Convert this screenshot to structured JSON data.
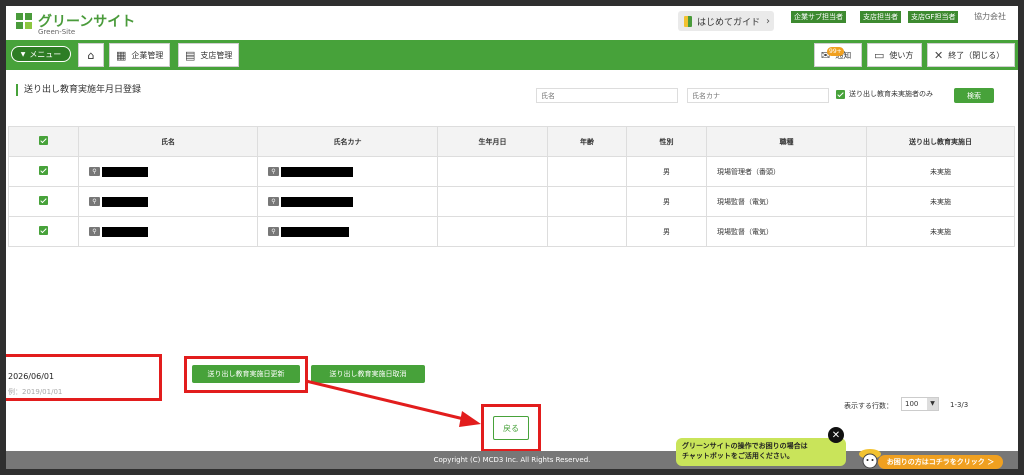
{
  "header": {
    "logo_text": "グリーンサイト",
    "logo_sub": "Green-Site",
    "guide_label": "はじめてガイド",
    "roles": [
      "企業サブ担当者",
      "支店担当者",
      "支店GF担当者"
    ],
    "role_plain": "協力会社"
  },
  "nav": {
    "menu_label": "メニュー",
    "company_label": "企業管理",
    "branch_label": "支店管理",
    "notice_label": "通知",
    "notice_badge": "99+",
    "howto_label": "使い方",
    "exit_label": "終了（閉じる）"
  },
  "page": {
    "title": "送り出し教育実施年月日登録",
    "name_placeholder": "氏名",
    "kana_placeholder": "氏名カナ",
    "filter_label": "送り出し教育未実施者のみ",
    "search_label": "検索"
  },
  "table": {
    "headers": [
      "氏名",
      "氏名カナ",
      "生年月日",
      "年齢",
      "性別",
      "職種",
      "送り出し教育実施日"
    ],
    "rows": [
      {
        "gender": "男",
        "job": "現場管理者（番頭）",
        "status": "未実施"
      },
      {
        "gender": "男",
        "job": "現場監督（電気）",
        "status": "未実施"
      },
      {
        "gender": "男",
        "job": "現場監督（電気）",
        "status": "未実施"
      }
    ]
  },
  "controls": {
    "date_value": "2026/06/01",
    "date_hint": "例：2019/01/01",
    "update_label": "送り出し教育実施日更新",
    "cancel_label": "送り出し教育実施日取消",
    "back_label": "戻る",
    "rows_label": "表示する行数：",
    "rows_value": "100",
    "page_info": "1-3/3"
  },
  "footer": {
    "copyright": "Copyright (C) MCD3 Inc. All Rights Reserved."
  },
  "chat": {
    "line1": "グリーンサイトの操作でお困りの場合は",
    "line2": "チャットボットをご活用ください。",
    "cta": "お困りの方はコチラをクリック ＞"
  },
  "colors": {
    "brand": "#47a23a",
    "annotation": "#e21d1d"
  }
}
